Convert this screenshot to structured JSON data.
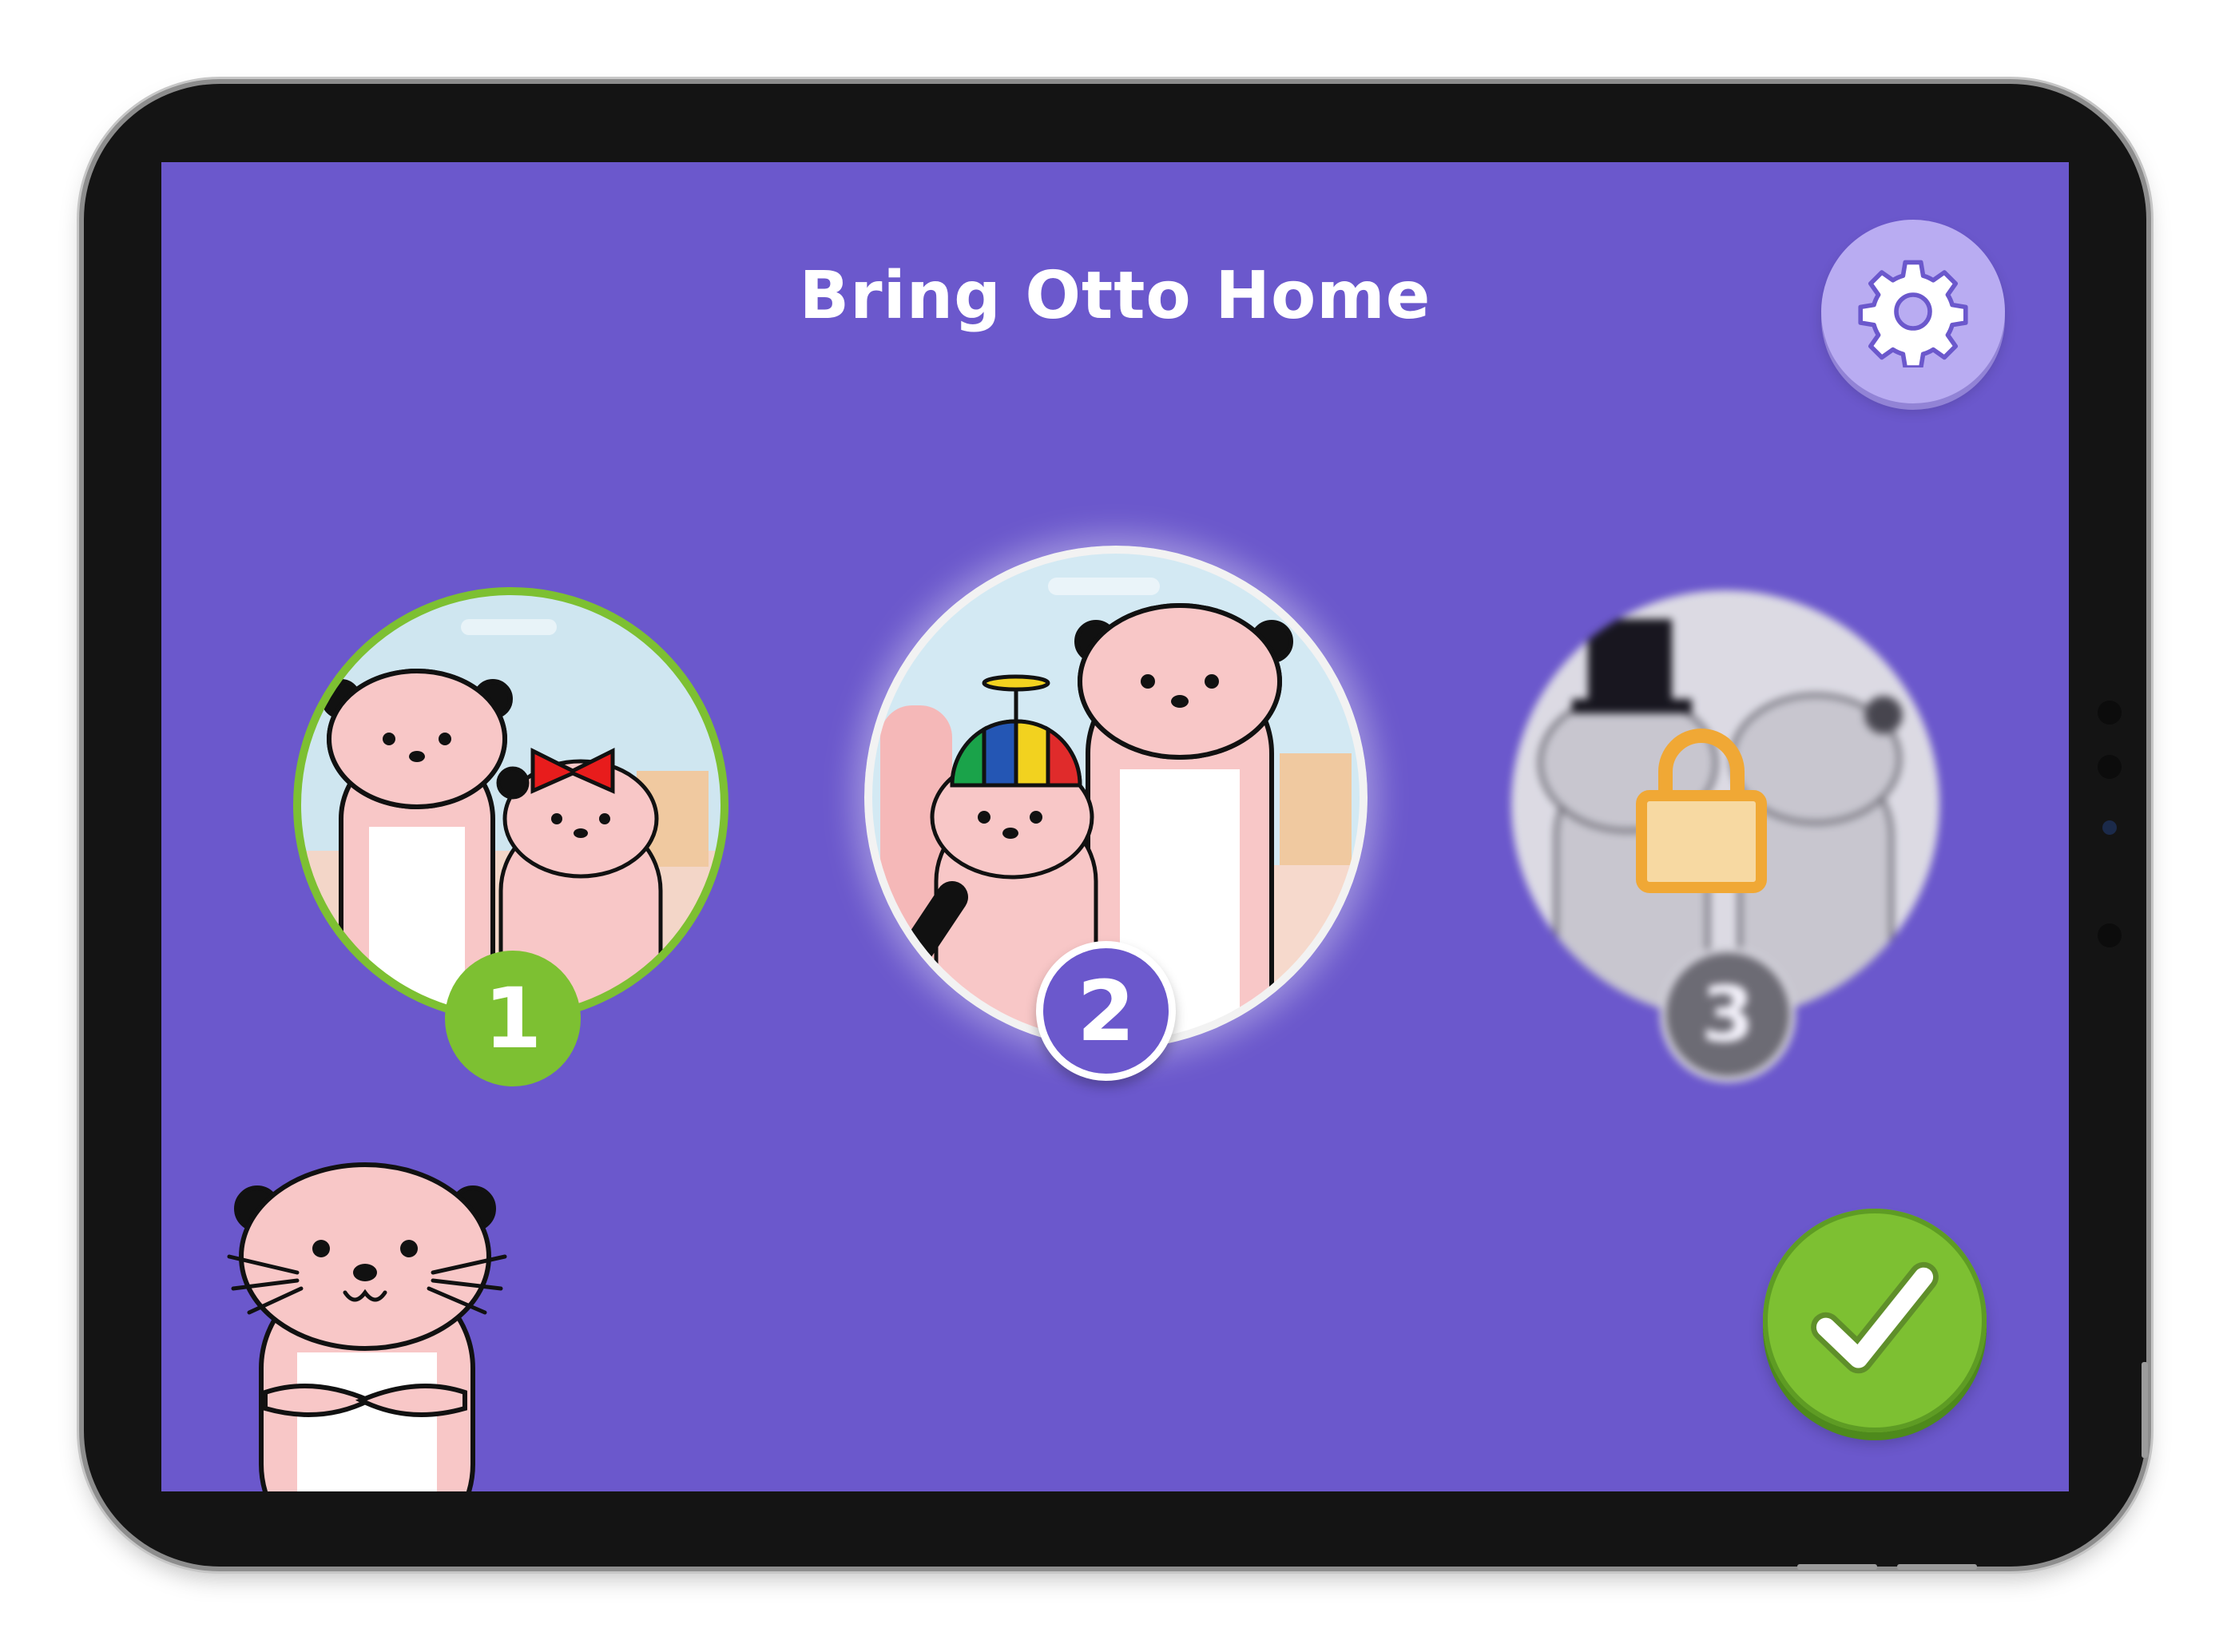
{
  "screen": {
    "title": "Bring Otto Home",
    "background_color": "#6b58cc"
  },
  "header": {
    "settings_icon": "gear-icon"
  },
  "levels": [
    {
      "number": "1",
      "state": "completed",
      "ring_color": "#7dc032",
      "accessory": "red-bow"
    },
    {
      "number": "2",
      "state": "current",
      "ring_color": "#f2f2f2",
      "accessory": "propeller-beanie"
    },
    {
      "number": "3",
      "state": "locked",
      "ring_color": "#dadada",
      "accessory": "top-hat",
      "lock_icon": "lock-icon"
    }
  ],
  "footer": {
    "confirm_icon": "checkmark-icon",
    "confirm_color": "#7dc032"
  },
  "mascot": {
    "name_icon": "otto-character"
  }
}
